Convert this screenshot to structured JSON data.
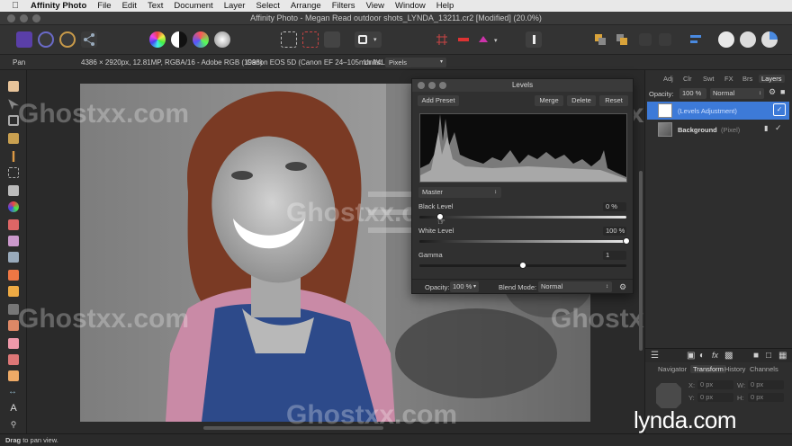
{
  "menubar": {
    "app_name": "Affinity Photo",
    "items": [
      "File",
      "Edit",
      "Text",
      "Document",
      "Layer",
      "Select",
      "Arrange",
      "Filters",
      "View",
      "Window",
      "Help"
    ]
  },
  "window": {
    "title": "Affinity Photo - Megan Read outdoor shots_LYNDA_13211.cr2 [Modified] (20.0%)"
  },
  "context": {
    "tool_name": "Pan",
    "image_info": "4386 × 2920px, 12.81MP, RGBA/16 - Adobe RGB (1998)",
    "camera_info": "Canon EOS 5D (Canon EF 24–105mm f/4L IS)",
    "units_label": "Units:",
    "units_value": "Pixels"
  },
  "levels_dialog": {
    "title": "Levels",
    "add_preset": "Add Preset",
    "merge": "Merge",
    "delete": "Delete",
    "reset": "Reset",
    "channel": "Master",
    "black_level_label": "Black Level",
    "black_level_value": "0 %",
    "white_level_label": "White Level",
    "white_level_value": "100 %",
    "gamma_label": "Gamma",
    "gamma_value": "1",
    "opacity_label": "Opacity:",
    "opacity_value": "100 %",
    "blend_mode_label": "Blend Mode:",
    "blend_mode_value": "Normal",
    "black_level_fraction": 0.1,
    "white_level_fraction": 1.0,
    "gamma_fraction": 0.5
  },
  "right_panel": {
    "tabs": [
      "Adj",
      "Clr",
      "Swt",
      "FX",
      "Brs",
      "Layers"
    ],
    "opacity_label": "Opacity:",
    "opacity_value": "100 %",
    "blend_value": "Normal",
    "layers": [
      {
        "name": "(Levels Adjustment)",
        "selected": true
      },
      {
        "name": "Background",
        "type": "(Pixel)",
        "selected": false
      }
    ],
    "bottom_tabs": [
      "Navigator",
      "Transform",
      "History",
      "Channels"
    ],
    "transform_fields": [
      {
        "label": "X:",
        "value": "0 px"
      },
      {
        "label": "W:",
        "value": "0 px"
      },
      {
        "label": "Y:",
        "value": "0 px"
      },
      {
        "label": "H:",
        "value": "0 px"
      }
    ]
  },
  "status": {
    "hint_bold": "Drag",
    "hint_text": "to pan view."
  },
  "watermarks": [
    "Ghostxx.com",
    "Ghostxx.com",
    "Ghostxx.com",
    "Ghostxx.com",
    "Ghostxx.com",
    "Ghostxx.com",
    "Ghostxx.com"
  ],
  "brand": "lynda.com",
  "colors": {
    "accent_blue": "#3d7ad8",
    "shirt_blue": "#2d4a8a",
    "shirt_pink": "#c98aa6"
  }
}
